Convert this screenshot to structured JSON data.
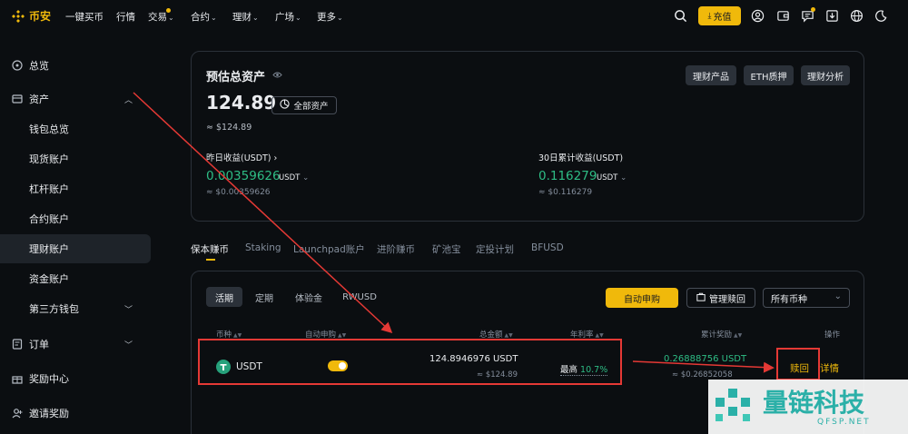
{
  "nav": {
    "logo": "币安",
    "items": [
      "一键买币",
      "行情",
      "交易",
      "合约",
      "理财",
      "广场",
      "更多"
    ],
    "deposit": "充值"
  },
  "sidebar": {
    "overview": "总览",
    "assets": "资产",
    "sub": [
      "钱包总览",
      "现货账户",
      "杠杆账户",
      "合约账户",
      "理财账户",
      "资金账户",
      "第三方钱包"
    ],
    "orders": "订单",
    "rewards": "奖励中心",
    "invite": "邀请奖励"
  },
  "summary": {
    "title": "预估总资产",
    "total": "124.89",
    "all_assets": "全部资产",
    "total_fiat": "≈ $124.89",
    "buttons": [
      "理财产品",
      "ETH质押",
      "理财分析"
    ],
    "yesterday_label": "昨日收益(USDT)",
    "yesterday_value": "0.00359626",
    "yesterday_unit": "USDT",
    "yesterday_fiat": "≈ $0.00359626",
    "month_label": "30日累计收益(USDT)",
    "month_value": "0.116279",
    "month_unit": "USDT",
    "month_fiat": "≈ $0.116279"
  },
  "tabs": [
    "保本赚币",
    "Staking",
    "Launchpad账户",
    "进阶赚币",
    "矿池宝",
    "定投计划",
    "BFUSD"
  ],
  "subtabs": [
    "活期",
    "定期",
    "体验金",
    "RWUSD"
  ],
  "actions": {
    "auto_subscribe": "自动申购",
    "manage_redeem": "管理赎回",
    "coin_select": "所有币种"
  },
  "table": {
    "headers": [
      "币种",
      "自动申购",
      "总金额",
      "年利率",
      "累计奖励",
      "操作"
    ],
    "row": {
      "coin": "USDT",
      "total": "124.8946976 USDT",
      "total_fiat": "≈ $124.89",
      "apr_prefix": "最高",
      "apr": "10.7%",
      "reward": "0.26888756 USDT",
      "reward_fiat": "≈ $0.26852058",
      "redeem": "赎回",
      "detail": "详情"
    }
  },
  "watermark": {
    "name": "量链科技",
    "domain": "QFSP.NET"
  },
  "colors": {
    "accent": "#f0b90b",
    "positive": "#2ebd85",
    "annotation": "#e53935",
    "watermark": "#2bb0a8"
  }
}
